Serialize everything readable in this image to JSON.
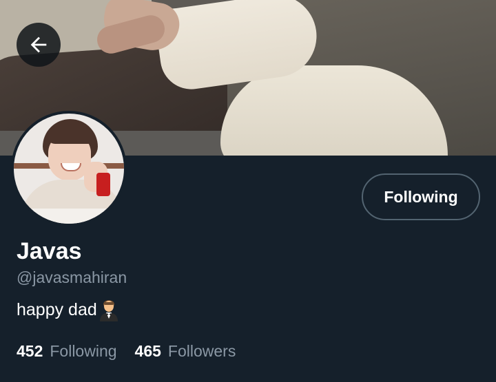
{
  "profile": {
    "name": "Javas",
    "handle": "@javasmahiran",
    "bio": "happy dad",
    "bio_emoji": "man-in-tuxedo-emoji"
  },
  "actions": {
    "follow_button_label": "Following",
    "back_icon": "arrow-left-icon"
  },
  "stats": {
    "following_count": "452",
    "following_label": "Following",
    "followers_count": "465",
    "followers_label": "Followers"
  },
  "colors": {
    "background": "#15202b",
    "text_primary": "#ffffff",
    "text_secondary": "#8b98a5",
    "button_border": "#536471"
  }
}
